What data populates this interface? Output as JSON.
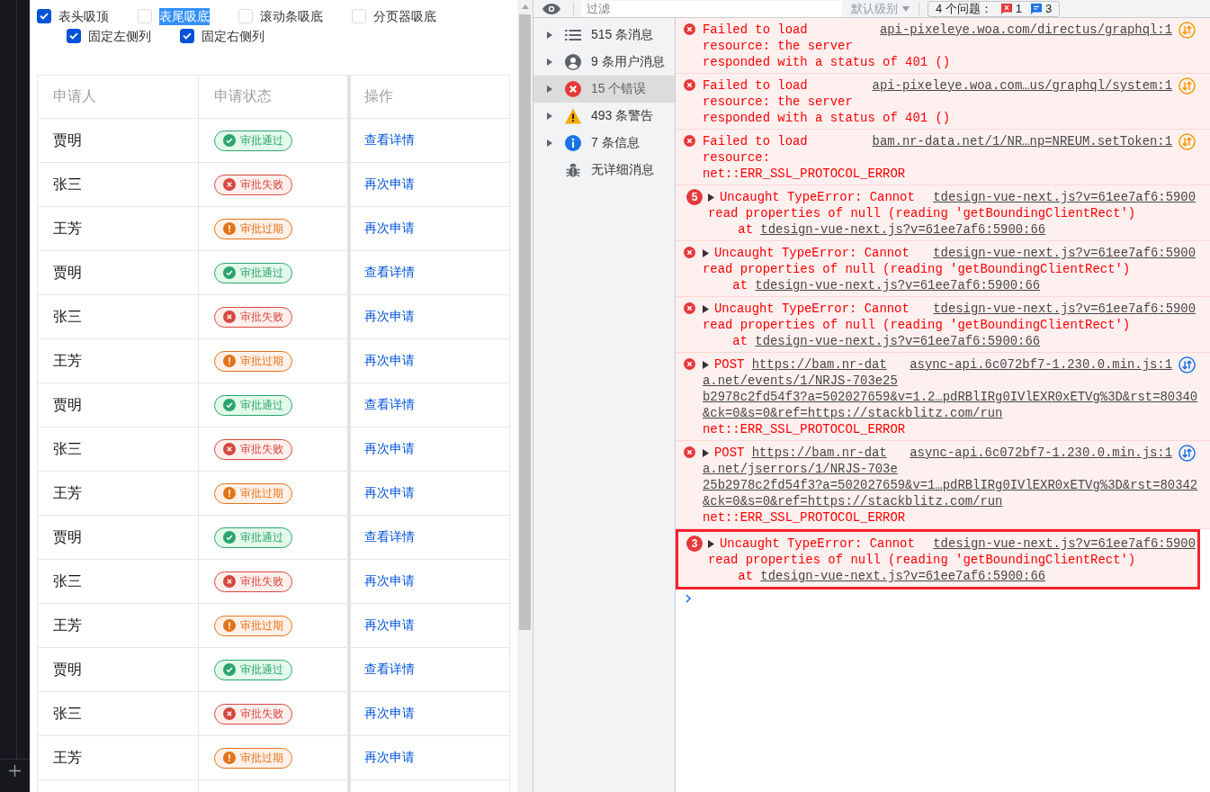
{
  "page": {
    "option_rows": [
      [
        {
          "label": "表头吸顶",
          "checked": true,
          "highlighted": false
        },
        {
          "label": "表尾吸底",
          "checked": false,
          "highlighted": true
        },
        {
          "label": "滚动条吸底",
          "checked": false,
          "highlighted": false
        },
        {
          "label": "分页器吸底",
          "checked": false,
          "highlighted": false
        }
      ],
      [
        {
          "label": "固定左侧列",
          "checked": true,
          "highlighted": false
        },
        {
          "label": "固定右侧列",
          "checked": true,
          "highlighted": false
        }
      ]
    ],
    "table": {
      "columns": [
        "申请人",
        "申请状态",
        "操作"
      ],
      "rows": [
        {
          "applicant": "贾明",
          "status": {
            "kind": "approved",
            "label": "审批通过"
          },
          "action": "查看详情"
        },
        {
          "applicant": "张三",
          "status": {
            "kind": "failed",
            "label": "审批失败"
          },
          "action": "再次申请"
        },
        {
          "applicant": "王芳",
          "status": {
            "kind": "expired",
            "label": "审批过期"
          },
          "action": "再次申请"
        },
        {
          "applicant": "贾明",
          "status": {
            "kind": "approved",
            "label": "审批通过"
          },
          "action": "查看详情"
        },
        {
          "applicant": "张三",
          "status": {
            "kind": "failed",
            "label": "审批失败"
          },
          "action": "再次申请"
        },
        {
          "applicant": "王芳",
          "status": {
            "kind": "expired",
            "label": "审批过期"
          },
          "action": "再次申请"
        },
        {
          "applicant": "贾明",
          "status": {
            "kind": "approved",
            "label": "审批通过"
          },
          "action": "查看详情"
        },
        {
          "applicant": "张三",
          "status": {
            "kind": "failed",
            "label": "审批失败"
          },
          "action": "再次申请"
        },
        {
          "applicant": "王芳",
          "status": {
            "kind": "expired",
            "label": "审批过期"
          },
          "action": "再次申请"
        },
        {
          "applicant": "贾明",
          "status": {
            "kind": "approved",
            "label": "审批通过"
          },
          "action": "查看详情"
        },
        {
          "applicant": "张三",
          "status": {
            "kind": "failed",
            "label": "审批失败"
          },
          "action": "再次申请"
        },
        {
          "applicant": "王芳",
          "status": {
            "kind": "expired",
            "label": "审批过期"
          },
          "action": "再次申请"
        },
        {
          "applicant": "贾明",
          "status": {
            "kind": "approved",
            "label": "审批通过"
          },
          "action": "查看详情"
        },
        {
          "applicant": "张三",
          "status": {
            "kind": "failed",
            "label": "审批失败"
          },
          "action": "再次申请"
        },
        {
          "applicant": "王芳",
          "status": {
            "kind": "expired",
            "label": "审批过期"
          },
          "action": "再次申请"
        }
      ]
    }
  },
  "devtools": {
    "toolbar": {
      "filter": {
        "placeholder": "过滤"
      },
      "level_menu": {
        "label": "默认级别",
        "disabled": true
      },
      "issues": {
        "label": "4 个问题：",
        "errors": "1",
        "infos": "3"
      }
    },
    "sidebar": {
      "items": [
        {
          "kind": "list",
          "label": "515 条消息",
          "expandable": true,
          "selected": false
        },
        {
          "kind": "user",
          "label": "9 条用户消息",
          "expandable": true,
          "selected": false
        },
        {
          "kind": "error",
          "label": "15 个错误",
          "expandable": true,
          "selected": true
        },
        {
          "kind": "warning",
          "label": "493 条警告",
          "expandable": true,
          "selected": false
        },
        {
          "kind": "info",
          "label": "7 条信息",
          "expandable": true,
          "selected": false
        },
        {
          "kind": "verbose",
          "label": "无详细消息",
          "expandable": false,
          "selected": false
        }
      ]
    },
    "messages": [
      {
        "expandable": false,
        "lines": [
          [
            {
              "kind": "text",
              "text": "Failed to load"
            }
          ],
          [
            {
              "kind": "text",
              "text": "resource: the server"
            }
          ],
          [
            {
              "kind": "text",
              "text": "responded with a status of 401 ()"
            }
          ]
        ],
        "source": "api-pixeleye.woa.com/directus/graphql:1",
        "source_icon": {
          "color": "#f29900"
        },
        "highlighted": false
      },
      {
        "expandable": false,
        "lines": [
          [
            {
              "kind": "text",
              "text": "Failed to load"
            }
          ],
          [
            {
              "kind": "text",
              "text": "resource: the server"
            }
          ],
          [
            {
              "kind": "text",
              "text": "responded with a status of 401 ()"
            }
          ]
        ],
        "source": "api-pixeleye.woa.com…us/graphql/system:1",
        "source_icon": {
          "color": "#f29900"
        },
        "highlighted": false
      },
      {
        "expandable": false,
        "lines": [
          [
            {
              "kind": "text",
              "text": "Failed to load"
            }
          ],
          [
            {
              "kind": "text",
              "text": "resource:"
            }
          ],
          [
            {
              "kind": "text",
              "text": "net::ERR_SSL_PROTOCOL_ERROR"
            }
          ]
        ],
        "source": "bam.nr-data.net/1/NR…np=NREUM.setToken:1",
        "source_icon": {
          "color": "#f29900"
        },
        "highlighted": false
      },
      {
        "repeat_count": "5",
        "expandable": true,
        "lines": [
          [
            {
              "kind": "text",
              "text": "Uncaught TypeError: Cannot"
            }
          ],
          [
            {
              "kind": "text",
              "text": "read properties of null (reading 'getBoundingClientRect')"
            }
          ]
        ],
        "stack": [
          {
            "prefix": "at",
            "link": "tdesign-vue-next.js?v=61ee7af6:5900:66"
          }
        ],
        "source": "tdesign-vue-next.js?v=61ee7af6:5900",
        "highlighted": false
      },
      {
        "expandable": true,
        "lines": [
          [
            {
              "kind": "text",
              "text": "Uncaught TypeError: Cannot"
            }
          ],
          [
            {
              "kind": "text",
              "text": "read properties of null (reading 'getBoundingClientRect')"
            }
          ]
        ],
        "stack": [
          {
            "prefix": "at",
            "link": "tdesign-vue-next.js?v=61ee7af6:5900:66"
          }
        ],
        "source": "tdesign-vue-next.js?v=61ee7af6:5900",
        "highlighted": false
      },
      {
        "expandable": true,
        "lines": [
          [
            {
              "kind": "text",
              "text": "Uncaught TypeError: Cannot"
            }
          ],
          [
            {
              "kind": "text",
              "text": "read properties of null (reading 'getBoundingClientRect')"
            }
          ]
        ],
        "stack": [
          {
            "prefix": "at",
            "link": "tdesign-vue-next.js?v=61ee7af6:5900:66"
          }
        ],
        "source": "tdesign-vue-next.js?v=61ee7af6:5900",
        "highlighted": false
      },
      {
        "expandable": true,
        "lines": [
          [
            {
              "kind": "text",
              "text": "POST"
            },
            {
              "kind": "link",
              "text": "https://bam.nr-dat"
            }
          ],
          [
            {
              "kind": "link",
              "text": "a.net/events/1/NRJS-703e25"
            }
          ],
          [
            {
              "kind": "link",
              "text": "b2978c2fd54f3?a=502027659&v=1.2…pdRBlIRg0IVlEXR0xETVg%3D&rst=80340"
            }
          ],
          [
            {
              "kind": "link",
              "text": "&ck=0&s=0&ref=https://stackblitz.com/run"
            }
          ],
          [
            {
              "kind": "text",
              "text": "net::ERR_SSL_PROTOCOL_ERROR"
            }
          ]
        ],
        "source": "async-api.6c072bf7-1.230.0.min.js:1",
        "source_icon": {
          "color": "#1a73e8"
        },
        "highlighted": false
      },
      {
        "expandable": true,
        "lines": [
          [
            {
              "kind": "text",
              "text": "POST"
            },
            {
              "kind": "link",
              "text": "https://bam.nr-dat"
            }
          ],
          [
            {
              "kind": "link",
              "text": "a.net/jserrors/1/NRJS-703e"
            }
          ],
          [
            {
              "kind": "link",
              "text": "25b2978c2fd54f3?a=502027659&v=1…pdRBlIRg0IVlEXR0xETVg%3D&rst=80342"
            }
          ],
          [
            {
              "kind": "link",
              "text": "&ck=0&s=0&ref=https://stackblitz.com/run"
            }
          ],
          [
            {
              "kind": "text",
              "text": "net::ERR_SSL_PROTOCOL_ERROR"
            }
          ]
        ],
        "source": "async-api.6c072bf7-1.230.0.min.js:1",
        "source_icon": {
          "color": "#1a73e8"
        },
        "highlighted": false
      },
      {
        "repeat_count": "3",
        "expandable": true,
        "lines": [
          [
            {
              "kind": "text",
              "text": "Uncaught TypeError: Cannot"
            }
          ],
          [
            {
              "kind": "text",
              "text": "read properties of null (reading 'getBoundingClientRect')"
            }
          ]
        ],
        "stack": [
          {
            "prefix": "at",
            "link": "tdesign-vue-next.js?v=61ee7af6:5900:66"
          }
        ],
        "source": "tdesign-vue-next.js?v=61ee7af6:5900",
        "highlighted": true
      }
    ]
  }
}
